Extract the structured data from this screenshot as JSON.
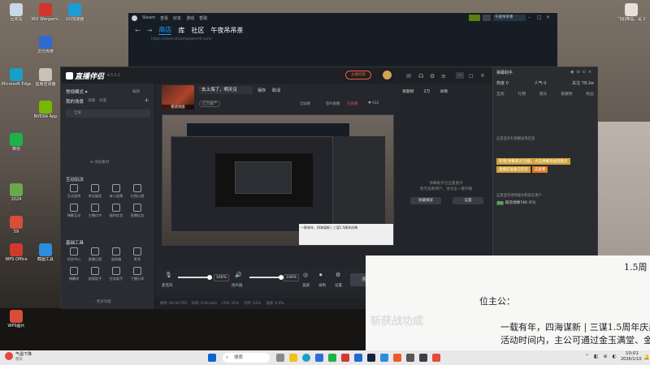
{
  "desktop": {
    "left_icons": [
      {
        "label": "回收站",
        "color": "#c9d7e6"
      },
      {
        "label": "360 Wargami...",
        "color": "#d0342c"
      },
      {
        "label": "UU加速器",
        "color": "#1e9ad6"
      },
      {
        "label": "次元传奇",
        "color": "#2e6ad0"
      },
      {
        "label": "Microsoft Edge",
        "color": "#18a0c8"
      },
      {
        "label": "国服登录器",
        "color": "#c9c2b8"
      },
      {
        "label": "微信",
        "color": "#1fb14b"
      },
      {
        "label": "NVIDIA App",
        "color": "#76b900"
      },
      {
        "label": "2024",
        "color": "#6aa84f"
      },
      {
        "label": "59",
        "color": "#d94c3a"
      },
      {
        "label": "WPS Office",
        "color": "#d03a2c"
      },
      {
        "label": "截图工具",
        "color": "#2d8de0"
      },
      {
        "label": "WPS图片",
        "color": "#d94c3a"
      }
    ],
    "top_labels": [
      "360杀毒",
      "设置中心",
      "AMD Soft",
      "Steam",
      "斗鱼直播",
      "AK加速器",
      "录制设置",
      "三国志",
      "WPS"
    ],
    "right_icon": {
      "label": "飞船降临，是 好的节目"
    }
  },
  "steam": {
    "title": "Steam",
    "menu": [
      "查看",
      "好友",
      "游戏",
      "帮助"
    ],
    "nav": {
      "store": "商店",
      "library": "库",
      "community": "社区",
      "user": "午夜吊吊茶"
    },
    "url": "https://store.steampowered.com/",
    "right": "午夜吊吊茶"
  },
  "live": {
    "logo": "直播伴侣",
    "version": "6.5.5.2",
    "header_right": {
      "beta": "主播权限",
      "follow": "开播信息",
      "share": "分享"
    },
    "mode": "常规模式",
    "edit": "编辑",
    "sidebar_tabs": {
      "scene": "我的场景",
      "a": "演播",
      "b": "动漫"
    },
    "scene_item": "全屏",
    "add_material": "添加素材",
    "interact_title": "互动玩法",
    "interact": [
      "互动游戏",
      "幸运抽奖",
      "本人投票",
      "礼物心愿",
      "弹幕互动",
      "主播口令",
      "福利红包",
      "直播红包"
    ],
    "tools_title": "基础工具",
    "tools": [
      "任务中心",
      "直播日程",
      "道具箱",
      "更多"
    ],
    "tools2": [
      "弹幕库",
      "房管助手",
      "任务助手",
      "下播分享"
    ],
    "more": "更多功能",
    "room": {
      "name": "去上海了，明天见",
      "save": "保存",
      "cancel": "取消",
      "cover": "修改封面",
      "live_tag": "已直播",
      "tag": "亿万僵尸",
      "fans": "全站榜",
      "visits": "签约直播",
      "count": "612"
    },
    "canvas_text": "一款有年，四海谋新 | 三谋1.5周年庆典",
    "audio": {
      "mic": "麦克风",
      "mic_pct": "100%",
      "speaker": "扬声器",
      "speaker_pct": "100%",
      "beauty": "美颜",
      "record": "录制",
      "settings": "设置",
      "go_live": "连播中..."
    },
    "status": [
      "帧率: 60.00 FPS",
      "码率: 0.00 kb/s",
      "CPU: 21%",
      "内存: 61%",
      "丢帧: 0.0%"
    ],
    "right_panel": {
      "rank": "贡献榜",
      "num": "2万",
      "members": "详情",
      "msg1": "弹幕助手已全面重开",
      "msg2": "暂无观看用户，请点击一键开播",
      "btn1": "隐藏横屏",
      "btn2": "设置"
    }
  },
  "danmaku": {
    "title": "弹幕助手",
    "stats": [
      {
        "k": "热度",
        "v": "0"
      },
      {
        "k": "人气",
        "v": "0"
      },
      {
        "k": "关注",
        "v": "78.2w"
      }
    ],
    "tabs": [
      "互动",
      "礼物",
      "观众",
      "贡献榜",
      "粉丝"
    ],
    "notice": "这里显示礼物赠送等信息",
    "highlight": "新增[弹幕黄页]功能，点击弹幕添加到黄页",
    "highlight2": "直播前准备已完毕",
    "go": "去查看",
    "footer": "这里显示进场观众和送礼用户",
    "user": "再见地球746",
    "user_act": "来啦",
    "cpu": "CPU 62%",
    "mem": "内存 58%",
    "fps": "FPS 60",
    "net": "网络 100%"
  },
  "document": {
    "title": "1.5周",
    "l1": "位主公：",
    "l2": "一载有年，四海谋新 | 三谋1.5周年庆典",
    "l3": "活动时间内，主公可通过金玉满堂、金",
    "l4": "斩获战功成"
  },
  "taskbar": {
    "weather_temp": "12°C",
    "weather_desc": "气温下降",
    "weather_sub": "明天",
    "search": "搜索",
    "time": "10:01",
    "date": "2026/1/10"
  }
}
